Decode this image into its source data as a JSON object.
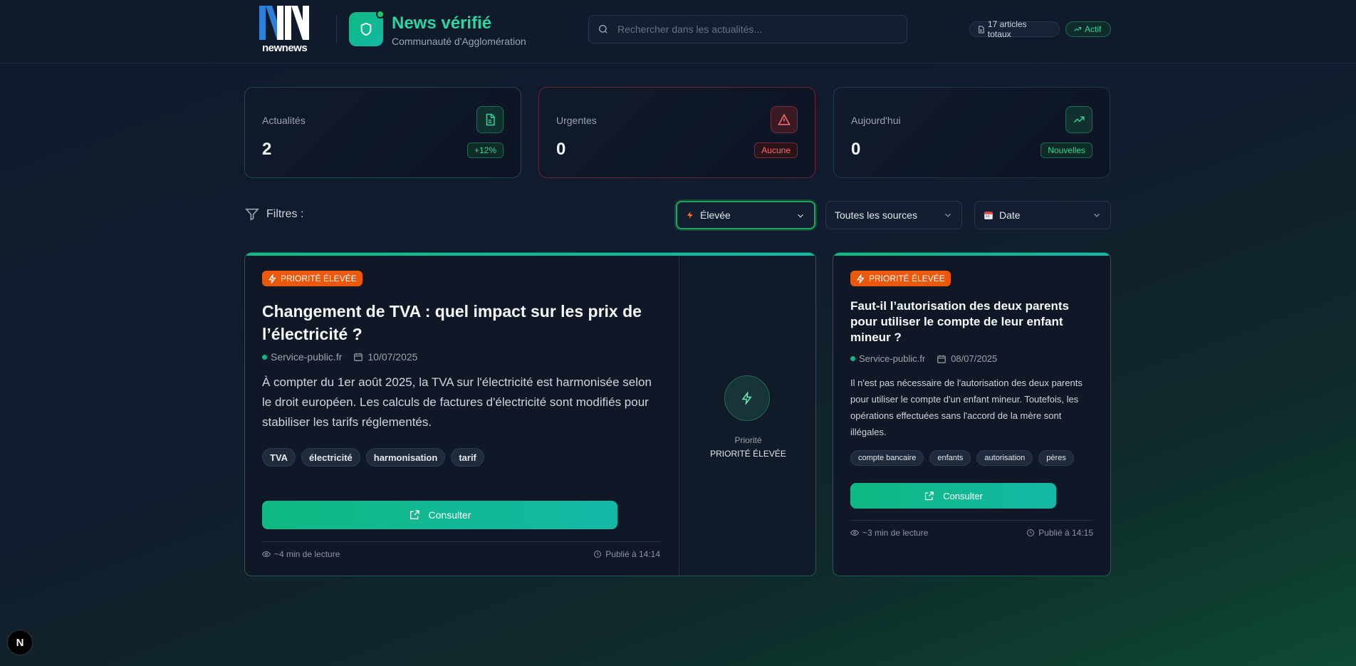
{
  "header": {
    "logo_word": "newnews",
    "brand_title": "News vérifié",
    "brand_subtitle": "Communauté d'Agglomération",
    "search_placeholder": "Rechercher dans les actualités...",
    "total_badge": "17 articles totaux",
    "status_badge": "Actif"
  },
  "stats": [
    {
      "label": "Actualités",
      "value": "2",
      "badge": "+12%",
      "icon": "file-text-icon"
    },
    {
      "label": "Urgentes",
      "value": "0",
      "badge": "Aucune",
      "icon": "alert-triangle-icon"
    },
    {
      "label": "Aujourd'hui",
      "value": "0",
      "badge": "Nouvelles",
      "icon": "trending-up-icon"
    }
  ],
  "filters": {
    "label": "Filtres :",
    "priority": "Élevée",
    "source": "Toutes les sources",
    "sort": "Date"
  },
  "articles": [
    {
      "priority": "PRIORITÉ ÉLEVÉE",
      "title": "Changement de TVA : quel impact sur les prix de l’électricité ?",
      "source": "Service-public.fr",
      "date": "10/07/2025",
      "excerpt": "À compter du 1er août 2025, la TVA sur l'électricité est harmonisée selon le droit européen. Les calculs de factures d'électricité sont modifiés pour stabiliser les tarifs réglementés.",
      "tags": [
        "TVA",
        "électricité",
        "harmonisation",
        "tarif"
      ],
      "button": "Consulter",
      "reading": "~4 min de lecture",
      "published": "Publié à 14:14",
      "side_label": "Priorité",
      "side_value": "PRIORITÉ ÉLEVÉE"
    },
    {
      "priority": "PRIORITÉ ÉLEVÉE",
      "title": "Faut-il l’autorisation des deux parents pour utiliser le compte de leur enfant mineur ?",
      "source": "Service-public.fr",
      "date": "08/07/2025",
      "excerpt": "Il n'est pas nécessaire de l'autorisation des deux parents pour utiliser le compte d'un enfant mineur. Toutefois, les opérations effectuées sans l'accord de la mère sont illégales.",
      "tags": [
        "compte bancaire",
        "enfants",
        "autorisation",
        "pères"
      ],
      "button": "Consulter",
      "reading": "~3 min de lecture",
      "published": "Publié à 14:15"
    }
  ],
  "corner_badge": "N",
  "colors": {
    "accent": "#10b981",
    "danger": "#ef4444",
    "priority": "#ea580c"
  }
}
